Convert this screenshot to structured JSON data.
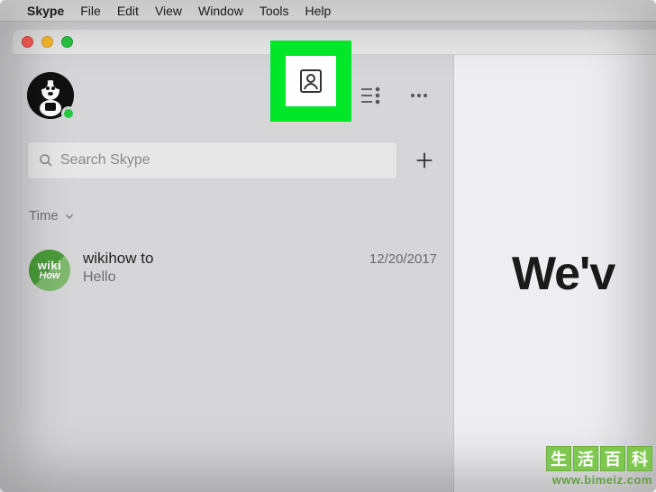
{
  "menubar": {
    "app": "Skype",
    "items": [
      "File",
      "Edit",
      "View",
      "Window",
      "Tools",
      "Help"
    ]
  },
  "sidebar": {
    "search_placeholder": "Search Skype",
    "filter_label": "Time",
    "conversations": [
      {
        "name": "wikihow to",
        "preview": "Hello",
        "date": "12/20/2017",
        "avatar_top": "wiki",
        "avatar_bot": "How"
      }
    ]
  },
  "main": {
    "welcome_fragment": "We'v"
  },
  "watermark": {
    "chars": [
      "生",
      "活",
      "百",
      "科"
    ],
    "url": "www.bimeiz.com"
  }
}
